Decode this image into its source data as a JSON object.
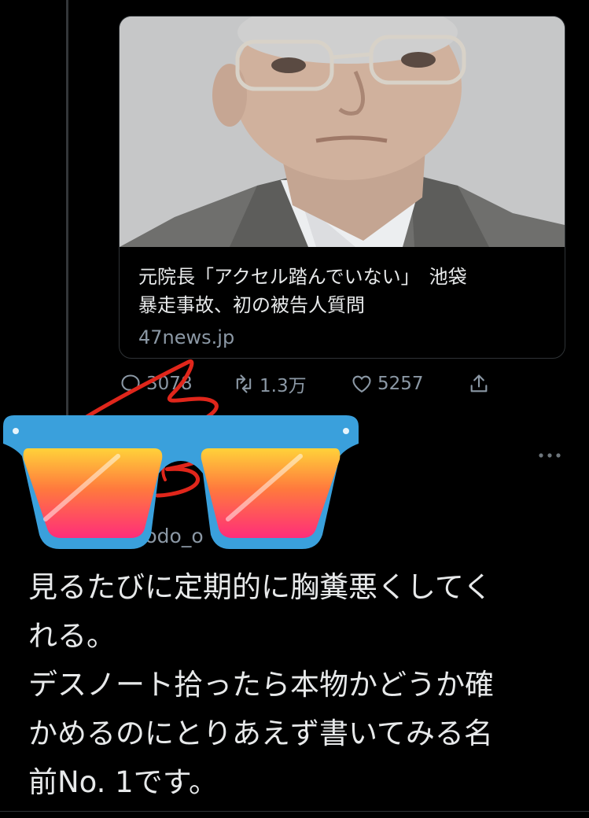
{
  "card": {
    "image_alt": "elderly man in glasses photo",
    "title_lines": [
      "元院長「アクセル踏んでいない」　池袋",
      "暴走事故、初の被告人質問"
    ],
    "domain": "47news.jp"
  },
  "actions": {
    "reply_count": "3078",
    "retweet_count": "1.3万",
    "like_count": "5257",
    "reply_icon": "reply-icon",
    "retweet_icon": "retweet-icon",
    "like_icon": "heart-icon",
    "share_icon": "share-icon"
  },
  "tweet": {
    "handle": "kyodo_o",
    "text_lines": [
      "見るたびに定期的に胸糞悪くしてく",
      "れる。",
      "デスノート拾ったら本物かどうか確",
      "かめるのにとりあえず書いてみる名",
      "前No. 1です。"
    ]
  },
  "overlay": {
    "sunglasses_frame_color": "#3aa0dc",
    "scribble_color": "#e0261b"
  }
}
